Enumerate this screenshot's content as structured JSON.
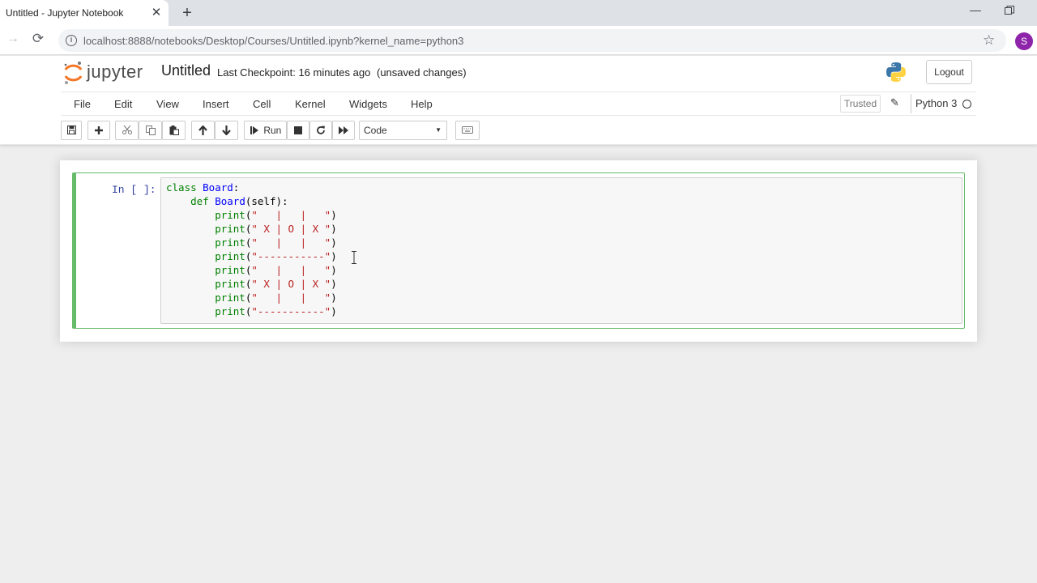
{
  "browser": {
    "tab_title": "Untitled - Jupyter Notebook",
    "tab_close": "✕",
    "new_tab": "+",
    "url": "localhost:8888/notebooks/Desktop/Courses/Untitled.ipynb?kernel_name=python3",
    "profile_initial": "S",
    "minimize_glyph": "—"
  },
  "header": {
    "logo_text": "jupyter",
    "notebook_title": "Untitled",
    "checkpoint": "Last Checkpoint: 16 minutes ago",
    "autosave": "(unsaved changes)",
    "logout": "Logout"
  },
  "menu": {
    "items": [
      "File",
      "Edit",
      "View",
      "Insert",
      "Cell",
      "Kernel",
      "Widgets",
      "Help"
    ],
    "trusted": "Trusted",
    "kernel": "Python 3"
  },
  "toolbar": {
    "run_label": "Run",
    "cell_type": "Code"
  },
  "cell": {
    "prompt": "In [ ]:",
    "lines": [
      [
        {
          "t": "class ",
          "c": "kw"
        },
        {
          "t": "Board",
          "c": "def"
        },
        {
          "t": ":",
          "c": "plain"
        }
      ],
      [
        {
          "t": "    def ",
          "c": "kw"
        },
        {
          "t": "Board",
          "c": "def"
        },
        {
          "t": "(self):",
          "c": "plain"
        }
      ],
      [
        {
          "t": "        print",
          "c": "bi"
        },
        {
          "t": "(",
          "c": "plain"
        },
        {
          "t": "\"   |   |   \"",
          "c": "str"
        },
        {
          "t": ")",
          "c": "plain"
        }
      ],
      [
        {
          "t": "        print",
          "c": "bi"
        },
        {
          "t": "(",
          "c": "plain"
        },
        {
          "t": "\" X | O | X \"",
          "c": "str"
        },
        {
          "t": ")",
          "c": "plain"
        }
      ],
      [
        {
          "t": "        print",
          "c": "bi"
        },
        {
          "t": "(",
          "c": "plain"
        },
        {
          "t": "\"   |   |   \"",
          "c": "str"
        },
        {
          "t": ")",
          "c": "plain"
        }
      ],
      [
        {
          "t": "        print",
          "c": "bi"
        },
        {
          "t": "(",
          "c": "plain"
        },
        {
          "t": "\"-----------\"",
          "c": "str"
        },
        {
          "t": ")",
          "c": "plain"
        }
      ],
      [
        {
          "t": "        print",
          "c": "bi"
        },
        {
          "t": "(",
          "c": "plain"
        },
        {
          "t": "\"   |   |   \"",
          "c": "str"
        },
        {
          "t": ")",
          "c": "plain"
        }
      ],
      [
        {
          "t": "        print",
          "c": "bi"
        },
        {
          "t": "(",
          "c": "plain"
        },
        {
          "t": "\" X | O | X \"",
          "c": "str"
        },
        {
          "t": ")",
          "c": "plain"
        }
      ],
      [
        {
          "t": "        print",
          "c": "bi"
        },
        {
          "t": "(",
          "c": "plain"
        },
        {
          "t": "\"   |   |   \"",
          "c": "str"
        },
        {
          "t": ")",
          "c": "plain"
        }
      ],
      [
        {
          "t": "        print",
          "c": "bi"
        },
        {
          "t": "(",
          "c": "plain"
        },
        {
          "t": "\"-----------\"",
          "c": "str"
        },
        {
          "t": ")",
          "c": "plain"
        }
      ]
    ]
  },
  "colors": {
    "selected_cell_border": "#66bb6a",
    "prompt": "#303f9f",
    "keyword": "#008000",
    "string": "#ba2121",
    "defname": "#0000ff"
  },
  "icons": [
    "info-icon",
    "star-icon",
    "save-icon",
    "plus-icon",
    "cut-icon",
    "copy-icon",
    "paste-icon",
    "arrow-up-icon",
    "arrow-down-icon",
    "step-forward-icon",
    "stop-icon",
    "restart-icon",
    "fast-forward-icon",
    "keyboard-icon",
    "pencil-icon",
    "python-logo"
  ]
}
